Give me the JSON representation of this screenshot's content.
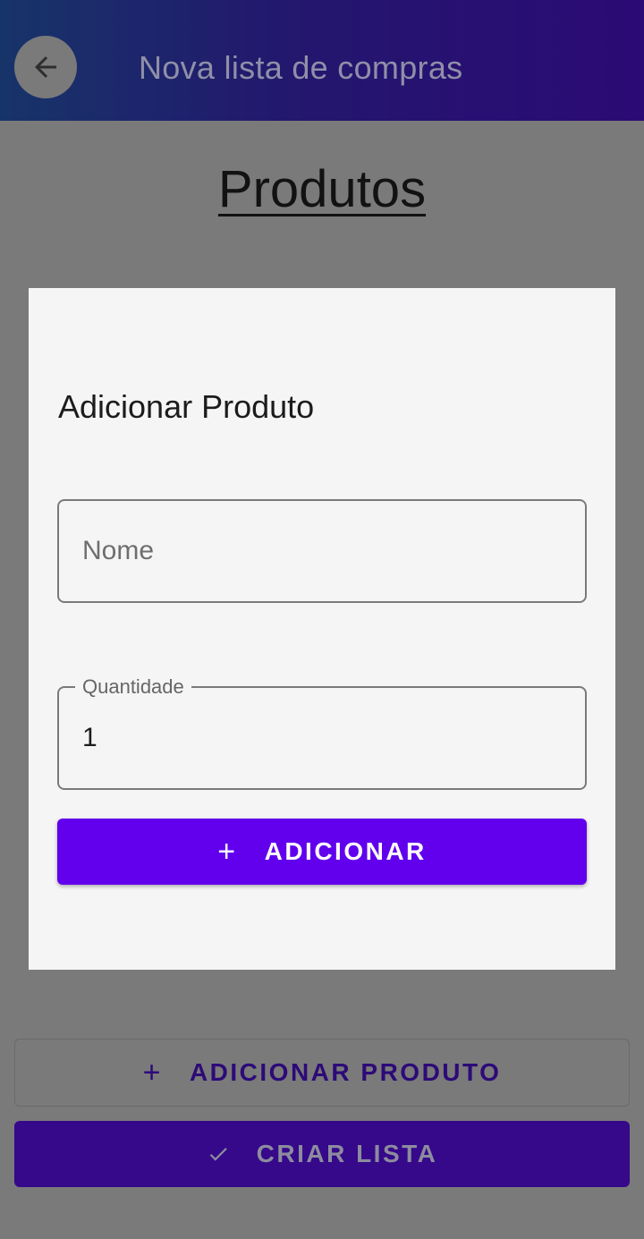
{
  "header": {
    "title": "Nova lista de compras",
    "back_icon": "arrow-left-icon"
  },
  "page": {
    "title": "Produtos"
  },
  "dialog": {
    "title": "Adicionar Produto",
    "name_field": {
      "placeholder": "Nome",
      "value": ""
    },
    "quantity_field": {
      "label": "Quantidade",
      "value": "1"
    },
    "add_button": {
      "label": "ADICIONAR",
      "icon": "plus-icon"
    }
  },
  "actions": {
    "add_product": {
      "label": "ADICIONAR PRODUTO",
      "icon": "plus-icon"
    },
    "create_list": {
      "label": "CRIAR LISTA",
      "icon": "check-icon"
    }
  },
  "colors": {
    "primary": "#6200ee",
    "scrim": "#7a7a7a",
    "dialog_background": "#f5f5f5"
  }
}
